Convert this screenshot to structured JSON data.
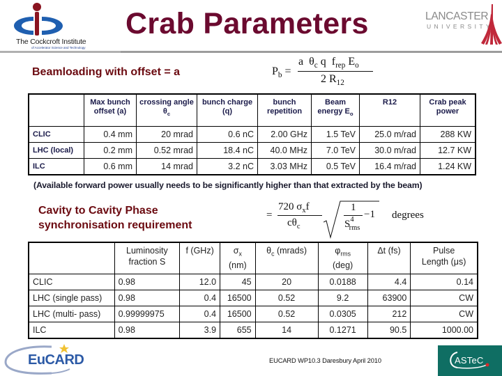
{
  "header": {
    "title": "Crab Parameters",
    "left_logo": {
      "name": "The Cockcroft Institute",
      "subtitle": "of Accelerator Science and Technology"
    },
    "right_logo": {
      "name": "LANCASTER",
      "subtitle": "UNIVERSITY"
    }
  },
  "section1": {
    "heading": "Beamloading with offset  = a",
    "formula": {
      "lhs": "P",
      "lhs_sub": "b",
      "numerator": [
        "a",
        "θ",
        "c",
        "q",
        "f",
        "rep",
        "E",
        "o"
      ],
      "denominator": [
        "2 R",
        "12"
      ]
    },
    "table": {
      "headers": [
        "",
        "Max bunch offset (a)",
        "crossing angle θ",
        "bunch charge (q)",
        "bunch repetition",
        "Beam energy E",
        "R12",
        "Crab peak power"
      ],
      "header_subscripts": {
        "2": "c",
        "5": "o"
      },
      "rows": [
        {
          "label": "CLIC",
          "cells": [
            "0.4 mm",
            "20 mrad",
            "0.6 nC",
            "2.00 GHz",
            "1.5 TeV",
            "25.0 m/rad",
            "288 KW"
          ]
        },
        {
          "label": "LHC (local)",
          "cells": [
            "0.2 mm",
            "0.52 mrad",
            "18.4 nC",
            "40.0 MHz",
            "7.0 TeV",
            "30.0 m/rad",
            "12.7 KW"
          ]
        },
        {
          "label": "ILC",
          "cells": [
            "0.6 mm",
            "14 mrad",
            "3.2 nC",
            "3.03 MHz",
            "0.5 TeV",
            "16.4 m/rad",
            "1.24 KW"
          ]
        }
      ]
    },
    "note": "(Available forward power usually needs to be significantly higher than that extracted by the beam)"
  },
  "section2": {
    "heading_line1": "Cavity to Cavity Phase",
    "heading_line2": "synchronisation requirement",
    "formula": {
      "eq": "=",
      "numerator": "720 σ",
      "numerator_sub": "x",
      "numerator_tail": "f",
      "denominator": "cθ",
      "denominator_sub": "c",
      "root_num": "1",
      "root_den": "S",
      "root_den_sup": "4",
      "root_den_sub": "rms",
      "minus_one": "−1",
      "unit": "degrees"
    },
    "table": {
      "headers": [
        {
          "main": "",
          "line2": ""
        },
        {
          "main": "Luminosity",
          "line2": "fraction S"
        },
        {
          "main": "f (GHz)",
          "line2": ""
        },
        {
          "main": "σ",
          "sub": "x",
          "line2": "(nm)"
        },
        {
          "main": "θ",
          "sub": "c",
          "tail": " (mrads)",
          "line2": ""
        },
        {
          "main": "φ",
          "sub": "rms",
          "line2": "(deg)"
        },
        {
          "main": "Δt (fs)",
          "line2": ""
        },
        {
          "main": "Pulse",
          "line2": "Length (μs)"
        }
      ],
      "rows": [
        {
          "label": "CLIC",
          "cells": [
            "0.98",
            "12.0",
            "45",
            "20",
            "0.0188",
            "4.4",
            "0.14"
          ]
        },
        {
          "label": "LHC (single pass)",
          "cells": [
            "0.98",
            "0.4",
            "16500",
            "0.52",
            "9.2",
            "63900",
            "CW"
          ]
        },
        {
          "label": "LHC (multi- pass)",
          "cells": [
            "0.99999975",
            "0.4",
            "16500",
            "0.52",
            "0.0305",
            "212",
            "CW"
          ]
        },
        {
          "label": "ILC",
          "cells": [
            "0.98",
            "3.9",
            "655",
            "14",
            "0.1271",
            "90.5",
            "1000.00"
          ]
        }
      ]
    }
  },
  "footer": {
    "left_logo": "EuCARD",
    "text": "EUCARD WP10.3 Daresbury April 2010",
    "right_logo": "ASTeC"
  },
  "colors": {
    "title": "#6b0a2f",
    "section_heading": "#6b0a10",
    "table_header_text": "#1b1b4a",
    "cockcroft_blue": "#1f5fb0",
    "cockcroft_red": "#8a1420",
    "astec_green": "#0f6e63",
    "eucard_blue": "#2c5aa6"
  }
}
